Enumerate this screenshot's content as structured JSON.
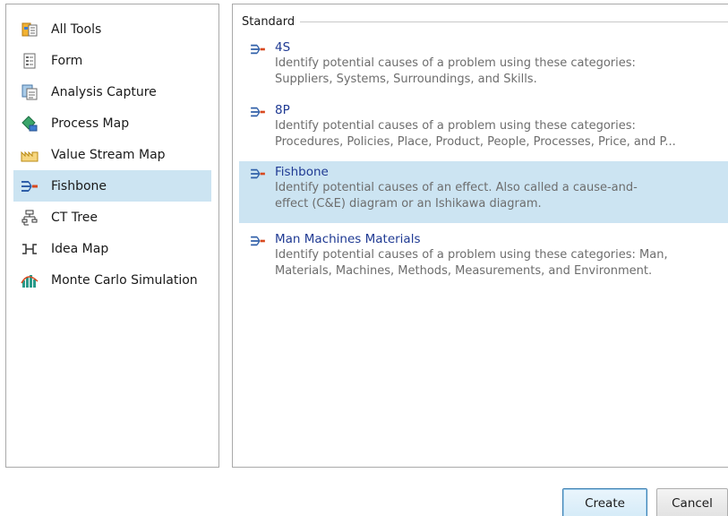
{
  "tools": [
    {
      "label": "All Tools",
      "icon": "all-tools-icon",
      "selected": false
    },
    {
      "label": "Form",
      "icon": "form-icon",
      "selected": false
    },
    {
      "label": "Analysis Capture",
      "icon": "analysis-capture-icon",
      "selected": false
    },
    {
      "label": "Process Map",
      "icon": "process-map-icon",
      "selected": false
    },
    {
      "label": "Value Stream Map",
      "icon": "value-stream-map-icon",
      "selected": false
    },
    {
      "label": "Fishbone",
      "icon": "fishbone-icon",
      "selected": true
    },
    {
      "label": "CT Tree",
      "icon": "ct-tree-icon",
      "selected": false
    },
    {
      "label": "Idea Map",
      "icon": "idea-map-icon",
      "selected": false
    },
    {
      "label": "Monte Carlo Simulation",
      "icon": "monte-carlo-icon",
      "selected": false
    }
  ],
  "templates": {
    "group_label": "Standard",
    "items": [
      {
        "name": "4S",
        "description_lines": [
          "Identify potential causes of a problem using these categories:",
          "Suppliers, Systems, Surroundings, and Skills."
        ],
        "selected": false
      },
      {
        "name": "8P",
        "description_lines": [
          "Identify potential causes of a problem using these categories:",
          "Procedures, Policies, Place, Product, People, Processes, Price, and P..."
        ],
        "selected": false
      },
      {
        "name": "Fishbone",
        "description_lines": [
          "Identify potential causes of an effect. Also called a cause-and-",
          "effect (C&E) diagram or an Ishikawa diagram."
        ],
        "selected": true
      },
      {
        "name": "Man Machines Materials",
        "description_lines": [
          "Identify potential causes of a problem using these categories: Man,",
          "Materials, Machines, Methods, Measurements, and Environment."
        ],
        "selected": false
      }
    ]
  },
  "buttons": {
    "create_label": "Create",
    "cancel_label": "Cancel"
  },
  "colors": {
    "selection": "#cce4f2",
    "template_name": "#1f3a93",
    "description": "#6d6d6d",
    "border": "#a9a9a9"
  }
}
